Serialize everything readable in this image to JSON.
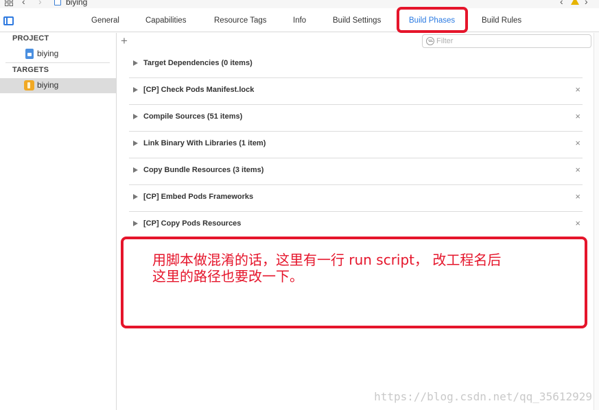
{
  "pathbar": {
    "breadcrumb": "biying"
  },
  "tabs": [
    {
      "label": "General"
    },
    {
      "label": "Capabilities"
    },
    {
      "label": "Resource Tags"
    },
    {
      "label": "Info"
    },
    {
      "label": "Build Settings"
    },
    {
      "label": "Build Phases",
      "active": true
    },
    {
      "label": "Build Rules"
    }
  ],
  "sidebar": {
    "project_header": "PROJECT",
    "project_item": "biying",
    "targets_header": "TARGETS",
    "target_item": "biying"
  },
  "content": {
    "add_symbol": "+",
    "filter_placeholder": "Filter",
    "phases": [
      {
        "title": "Target Dependencies (0 items)",
        "removable": false
      },
      {
        "title": "[CP] Check Pods Manifest.lock",
        "removable": true
      },
      {
        "title": "Compile Sources (51 items)",
        "removable": true
      },
      {
        "title": "Link Binary With Libraries (1 item)",
        "removable": true
      },
      {
        "title": "Copy Bundle Resources (3 items)",
        "removable": true
      },
      {
        "title": "[CP] Embed Pods Frameworks",
        "removable": true
      },
      {
        "title": "[CP] Copy Pods Resources",
        "removable": true
      }
    ],
    "close_symbol": "×"
  },
  "annotation": {
    "text": "用脚本做混淆的话，这里有一行 run script， 改工程名后\n这里的路径也要改一下。"
  },
  "watermark": "https://blog.csdn.net/qq_35612929",
  "colors": {
    "accent": "#2a7ae2",
    "highlight": "#e5152b"
  }
}
